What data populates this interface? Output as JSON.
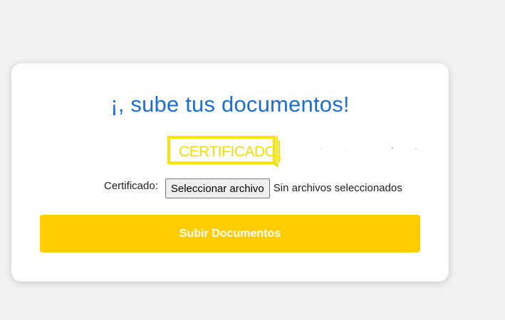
{
  "page": {
    "title": "¡, sube tus documentos!"
  },
  "logo": {
    "text": "CERTIFICADO",
    "color": "#f7e500"
  },
  "upload": {
    "label": "Certificado:",
    "button_label": "Seleccionar archivo",
    "status_text": "Sin archivos seleccionados"
  },
  "submit": {
    "label": "Subir Documentos",
    "color": "#ffcc00"
  },
  "colors": {
    "title": "#1a6fd6",
    "background": "#f2f2f2",
    "card": "#ffffff"
  }
}
